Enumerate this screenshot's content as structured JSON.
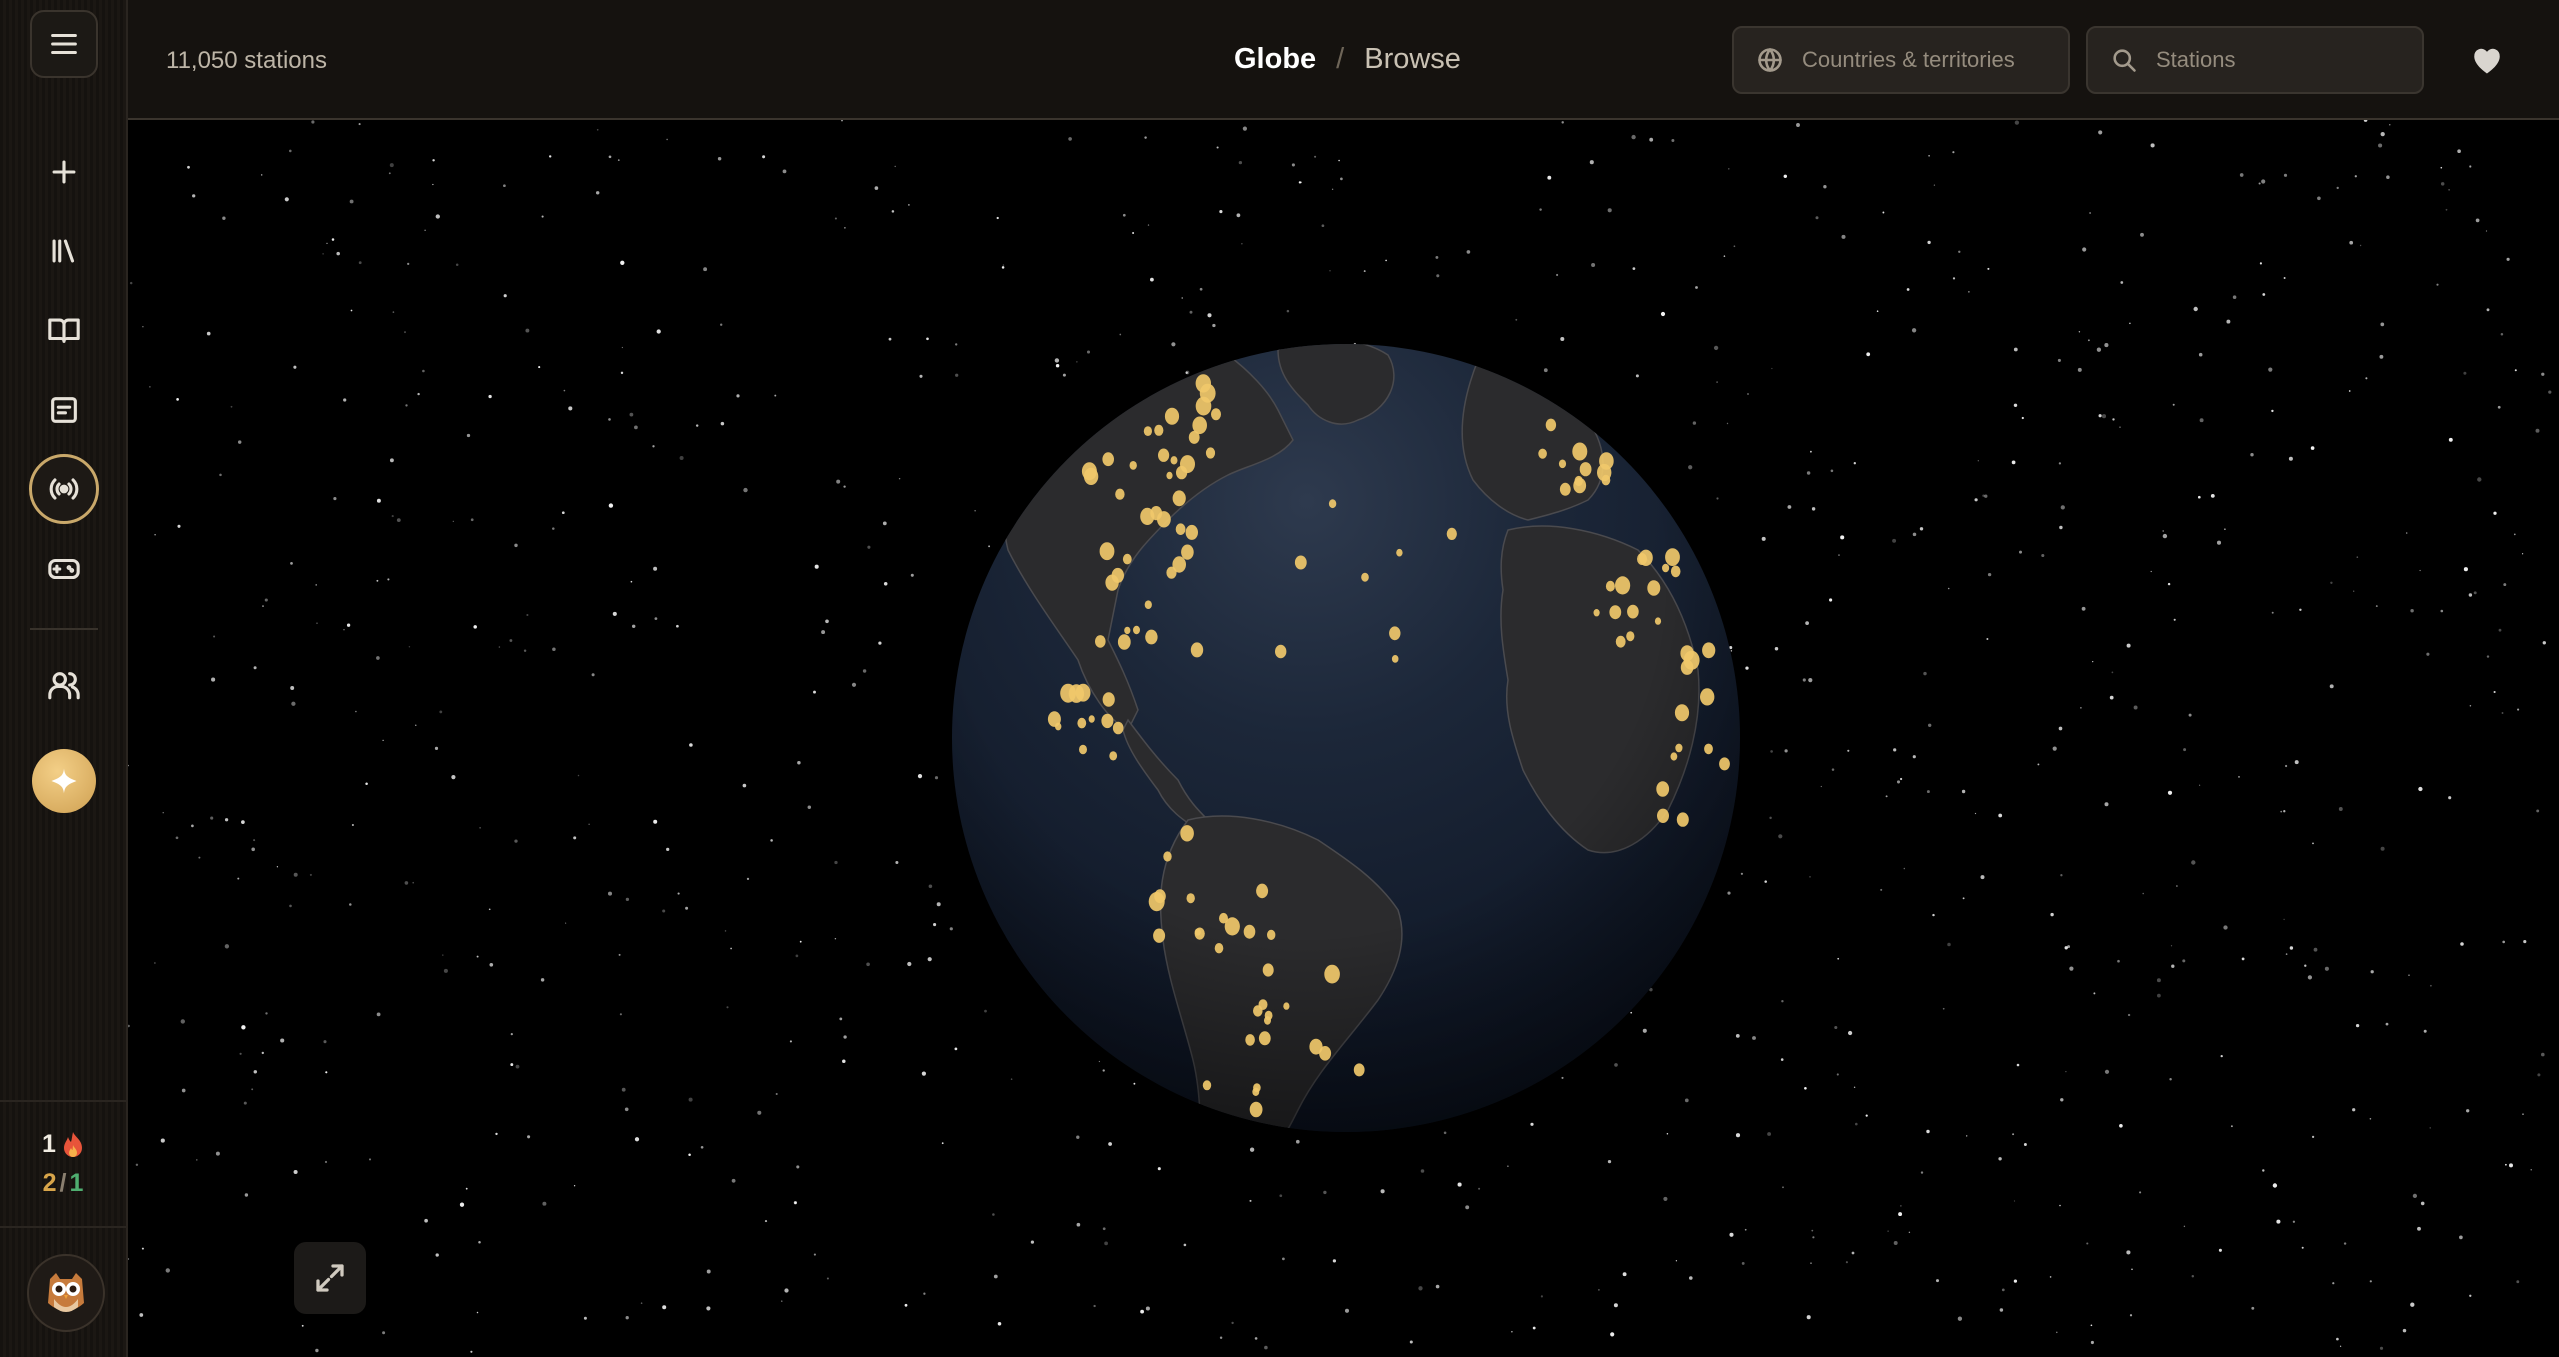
{
  "header": {
    "station_count": "11,050 stations",
    "breadcrumb": {
      "current": "Globe",
      "separator": "/",
      "sub": "Browse"
    },
    "country_filter": {
      "placeholder": "Countries & territories",
      "icon": "globe-icon"
    },
    "station_search": {
      "placeholder": "Stations",
      "icon": "search-icon"
    },
    "favorites_icon": "heart-icon"
  },
  "sidebar": {
    "items": [
      {
        "name": "menu",
        "icon": "hamburger-icon"
      },
      {
        "name": "add",
        "icon": "plus-icon"
      },
      {
        "name": "library",
        "icon": "library-icon"
      },
      {
        "name": "read",
        "icon": "book-open-icon"
      },
      {
        "name": "notes",
        "icon": "document-icon"
      },
      {
        "name": "radio",
        "icon": "radio-broadcast-icon",
        "active": true
      },
      {
        "name": "games",
        "icon": "gamepad-icon"
      },
      {
        "name": "people",
        "icon": "users-icon"
      },
      {
        "name": "assistant",
        "icon": "sparkle-icon"
      }
    ],
    "streak": {
      "value": "1",
      "icon": "flame-icon"
    },
    "score": {
      "correct": "2",
      "separator": "/",
      "total": "1"
    },
    "avatar_icon": "owl-avatar-icon"
  },
  "globe": {
    "ocean_color": "#1a2638",
    "land_color": "#2b2b2d",
    "station_color": "#f0c86a",
    "star_color": "#ffffff"
  },
  "controls": {
    "expand_icon": "expand-icon"
  }
}
